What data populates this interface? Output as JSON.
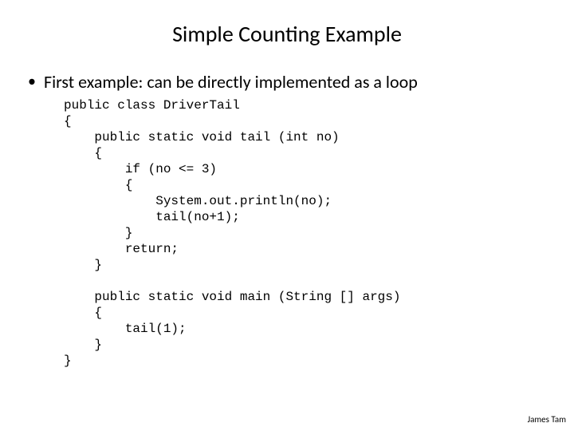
{
  "title": "Simple Counting Example",
  "bullet": {
    "text": "First example: can be directly implemented as a loop"
  },
  "code": "public class DriverTail\n{\n    public static void tail (int no)\n    {\n        if (no <= 3)\n        {\n            System.out.println(no);\n            tail(no+1);\n        }\n        return;\n    }\n\n    public static void main (String [] args)\n    {\n        tail(1);\n    }\n}",
  "footer": "James Tam"
}
